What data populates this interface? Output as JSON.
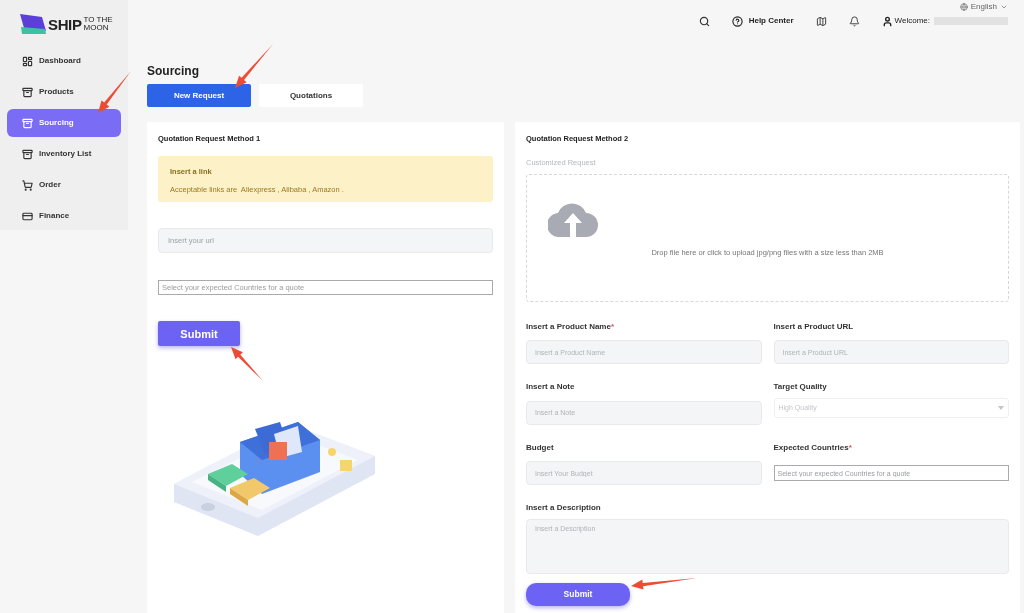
{
  "logo": {
    "word": "SHIP",
    "line_1": "TO THE",
    "line_2": "MOON"
  },
  "header": {
    "language": "English",
    "help": "Help Center",
    "welcome": "Welcome:"
  },
  "sidebar": {
    "items": [
      {
        "label": "Dashboard",
        "selected": false
      },
      {
        "label": "Products",
        "selected": false
      },
      {
        "label": "Sourcing",
        "selected": true
      },
      {
        "label": "Inventory List",
        "selected": false
      },
      {
        "label": "Order",
        "selected": false
      },
      {
        "label": "Finance",
        "selected": false
      }
    ]
  },
  "page_title": "Sourcing",
  "tabs": [
    {
      "label": "New Request",
      "selected": true
    },
    {
      "label": "Quotations",
      "selected": false
    }
  ],
  "method_1": {
    "title": "Quotation Request Method 1",
    "notice": {
      "title": "Insert a link",
      "text": "Acceptable links are  Aliexpress , Alibaba , Amazon ."
    },
    "url_field": {
      "placeholder": "Insert your url"
    },
    "countries_field": {
      "placeholder": "Select your expected Countries for a quote"
    },
    "submit": "Submit"
  },
  "method_2": {
    "title": "Quotation Request Method 2",
    "subtitle": "Customized Request",
    "upload_hint": "Drop file here or click to upload jpg/png files with a size less than 2MB",
    "fields": [
      {
        "kind": "input",
        "label": "Insert a Product Name",
        "mark": "*",
        "placeholder": "Insert a Product Name"
      },
      {
        "kind": "input",
        "label": "Insert a Product URL",
        "placeholder": "Insert a Product URL"
      },
      {
        "kind": "input",
        "label": "Insert a Note",
        "placeholder": "Insert a Note"
      },
      {
        "kind": "select",
        "label": "Target Quality",
        "placeholder": "High Quality"
      },
      {
        "kind": "input",
        "label": "Budget",
        "placeholder": "Insert Your Budget"
      },
      {
        "kind": "countries",
        "label": "Expected Countries",
        "mark": "*",
        "placeholder": "Select your expected Countries for a quote"
      }
    ],
    "description": {
      "label": "Insert a Description",
      "placeholder": "Insert a Description"
    },
    "submit": "Submit"
  }
}
